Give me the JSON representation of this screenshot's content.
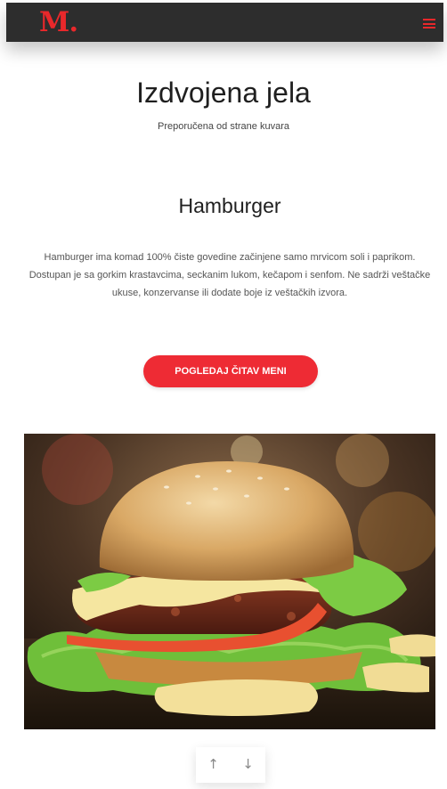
{
  "navbar": {
    "logo_text": "M.",
    "menu_icon": "hamburger-menu-icon",
    "accent_color": "#e9282b",
    "background_color": "#2d2d2d"
  },
  "featured": {
    "title": "Izdvojena jela",
    "subtitle": "Preporučena od strane kuvara"
  },
  "dish": {
    "name": "Hamburger",
    "description": "Hamburger ima komad 100% čiste govedine začinjene samo mrvicom soli i paprikom. Dostupan je sa gorkim krastavcima, seckanim lukom, kečapom i senfom. Ne sadrži veštačke ukuse, konzervanse ili dodate boje iz veštačkih izvora."
  },
  "cta": {
    "label": "POGLEDAJ ČITAV MENI",
    "color": "#ee2b34"
  },
  "carousel": {
    "prev_symbol": "↑",
    "next_symbol": "↓"
  }
}
